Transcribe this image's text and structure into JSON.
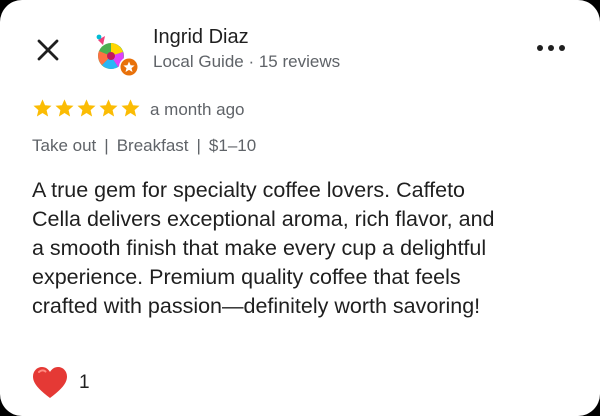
{
  "header": {
    "close_icon": "close-icon",
    "more_icon": "more-horizontal-icon",
    "author_name": "Ingrid Diaz",
    "author_meta": "Local Guide · 15 reviews",
    "avatar_icon": "party-hat-avatar",
    "badge_icon": "local-guide-star-badge",
    "badge_color": "#e8710a"
  },
  "rating": {
    "stars": 5,
    "max_stars": 5,
    "star_color": "#fbbc04",
    "time": "a month ago"
  },
  "tags": [
    "Take out",
    "Breakfast",
    "$1–10"
  ],
  "tag_separator": "|",
  "review_text": "A true gem for specialty coffee lovers. Caffeto\nCella delivers exceptional aroma, rich flavor, and\na smooth finish that make every cup a delightful\nexperience. Premium quality coffee that feels\ncrafted with passion—definitely worth savoring!",
  "reaction": {
    "icon": "red-heart-icon",
    "color": "#e53935",
    "count": "1"
  }
}
